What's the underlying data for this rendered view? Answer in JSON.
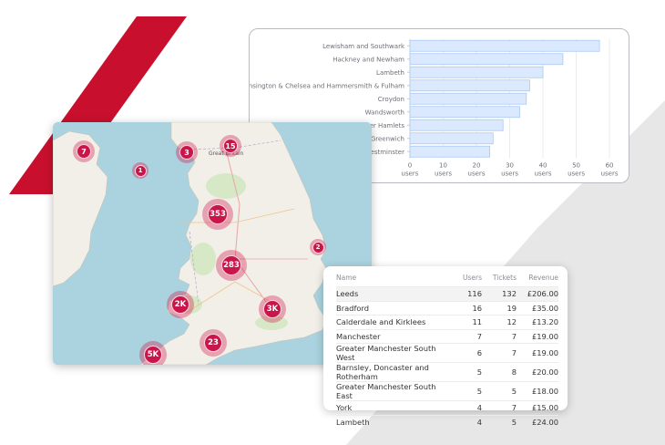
{
  "colors": {
    "accent": "#c8154a",
    "bar_fill": "#dbe9ff",
    "bar_stroke": "#a9c8f5",
    "red_stripe": "#c8102e",
    "grey_stripe": "#e7e7e8"
  },
  "chart_data": {
    "type": "bar",
    "orientation": "horizontal",
    "categories": [
      "Lewisham and Southwark",
      "Hackney and Newham",
      "Lambeth",
      "Kensington & Chelsea and Hammersmith & Fulham",
      "Croydon",
      "Wandsworth",
      "wer Hamlets",
      "d Greenwich",
      "Westminster"
    ],
    "values": [
      57,
      46,
      40,
      36,
      35,
      33,
      28,
      25,
      24
    ],
    "xlim": [
      0,
      63
    ],
    "xticks": [
      0,
      10,
      20,
      30,
      40,
      50,
      60
    ],
    "tick_suffix": "users",
    "grid": true
  },
  "map": {
    "place_labels": {
      "great_britain": "Great Britain"
    },
    "clusters": [
      {
        "label": "7",
        "size": "small"
      },
      {
        "label": "1",
        "size": "tiny"
      },
      {
        "label": "3",
        "size": "small"
      },
      {
        "label": "15",
        "size": "small"
      },
      {
        "label": "353",
        "size": "large"
      },
      {
        "label": "2",
        "size": "tiny"
      },
      {
        "label": "283",
        "size": "large"
      },
      {
        "label": "2K",
        "size": "medium"
      },
      {
        "label": "3K",
        "size": "medium"
      },
      {
        "label": "23",
        "size": "medium"
      },
      {
        "label": "5K",
        "size": "medium"
      }
    ]
  },
  "table": {
    "headers": {
      "name": "Name",
      "users": "Users",
      "tickets": "Tickets",
      "revenue": "Revenue"
    },
    "rows": [
      {
        "name": "Leeds",
        "users": "116",
        "tickets": "132",
        "revenue": "£206.00"
      },
      {
        "name": "Bradford",
        "users": "16",
        "tickets": "19",
        "revenue": "£35.00"
      },
      {
        "name": "Calderdale and Kirklees",
        "users": "11",
        "tickets": "12",
        "revenue": "£13.20"
      },
      {
        "name": "Manchester",
        "users": "7",
        "tickets": "7",
        "revenue": "£19.00"
      },
      {
        "name": "Greater Manchester South West",
        "users": "6",
        "tickets": "7",
        "revenue": "£19.00"
      },
      {
        "name": "Barnsley, Doncaster and Rotherham",
        "users": "5",
        "tickets": "8",
        "revenue": "£20.00"
      },
      {
        "name": "Greater Manchester South East",
        "users": "5",
        "tickets": "5",
        "revenue": "£18.00"
      },
      {
        "name": "York",
        "users": "4",
        "tickets": "7",
        "revenue": "£15.00"
      },
      {
        "name": "Lambeth",
        "users": "4",
        "tickets": "5",
        "revenue": "£24.00"
      }
    ]
  }
}
